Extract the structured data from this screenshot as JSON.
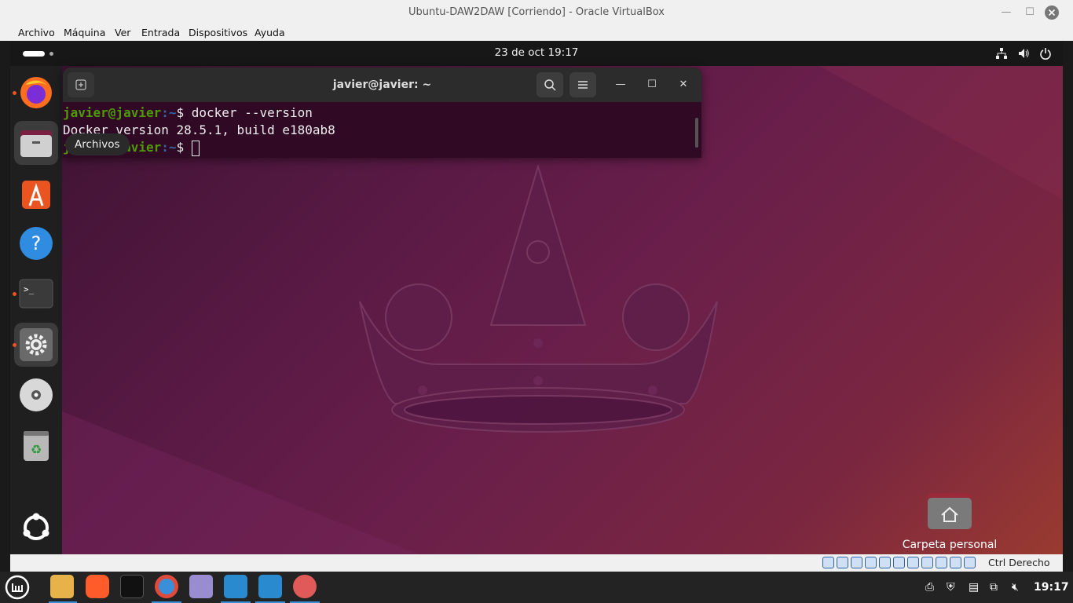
{
  "window": {
    "title": "Ubuntu-DAW2DAW [Corriendo] - Oracle VirtualBox"
  },
  "menu": [
    "Archivo",
    "Máquina",
    "Ver",
    "Entrada",
    "Dispositivos",
    "Ayuda"
  ],
  "topbar": {
    "clock": "23 de oct  19:17"
  },
  "terminal": {
    "title": "javier@javier: ~",
    "lines": [
      {
        "user": "javier@javier",
        "path": ":~",
        "prompt": "$ ",
        "text": "docker --version"
      },
      {
        "text": "Docker version 28.5.1, build e180ab8"
      },
      {
        "user": "javier@javier",
        "path": ":~",
        "prompt": "$ "
      }
    ]
  },
  "dock": {
    "tooltip": "Archivos",
    "items": [
      "firefox-icon",
      "files-icon",
      "app-center-icon",
      "help-icon",
      "terminal-icon",
      "settings-icon",
      "disc-icon",
      "trash-icon",
      "show-apps-icon"
    ]
  },
  "desktop": {
    "home_folder": "Carpeta personal"
  },
  "status": {
    "host_key": "Ctrl Derecho"
  },
  "taskbar": {
    "time": "19:17"
  },
  "colors": {
    "accent": "#e95420",
    "desktop": "#5a1a45",
    "terminal_bg": "#300a24",
    "prompt_user": "#4e9a06"
  }
}
